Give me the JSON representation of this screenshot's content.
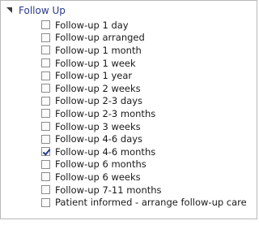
{
  "group": {
    "title": "Follow Up",
    "items": [
      {
        "label": "Follow-up 1 day",
        "checked": false
      },
      {
        "label": "Follow-up arranged",
        "checked": false
      },
      {
        "label": "Follow-up 1 month",
        "checked": false
      },
      {
        "label": "Follow-up 1 week",
        "checked": false
      },
      {
        "label": "Follow-up 1 year",
        "checked": false
      },
      {
        "label": "Follow-up 2 weeks",
        "checked": false
      },
      {
        "label": "Follow-up 2-3 days",
        "checked": false
      },
      {
        "label": "Follow-up 2-3 months",
        "checked": false
      },
      {
        "label": "Follow-up 3 weeks",
        "checked": false
      },
      {
        "label": "Follow-up 4-6 days",
        "checked": false
      },
      {
        "label": "Follow-up 4-6 months",
        "checked": true
      },
      {
        "label": "Follow-up 6 months",
        "checked": false
      },
      {
        "label": "Follow-up 6 weeks",
        "checked": false
      },
      {
        "label": "Follow-up 7-11 months",
        "checked": false
      },
      {
        "label": "Patient informed - arrange follow-up care",
        "checked": false
      }
    ]
  },
  "colors": {
    "header_text": "#2a3b8f",
    "check_mark": "#1f3b8a",
    "panel_border": "#b9b9b9"
  },
  "icons": {
    "expander": "triangle-expanded-icon"
  }
}
